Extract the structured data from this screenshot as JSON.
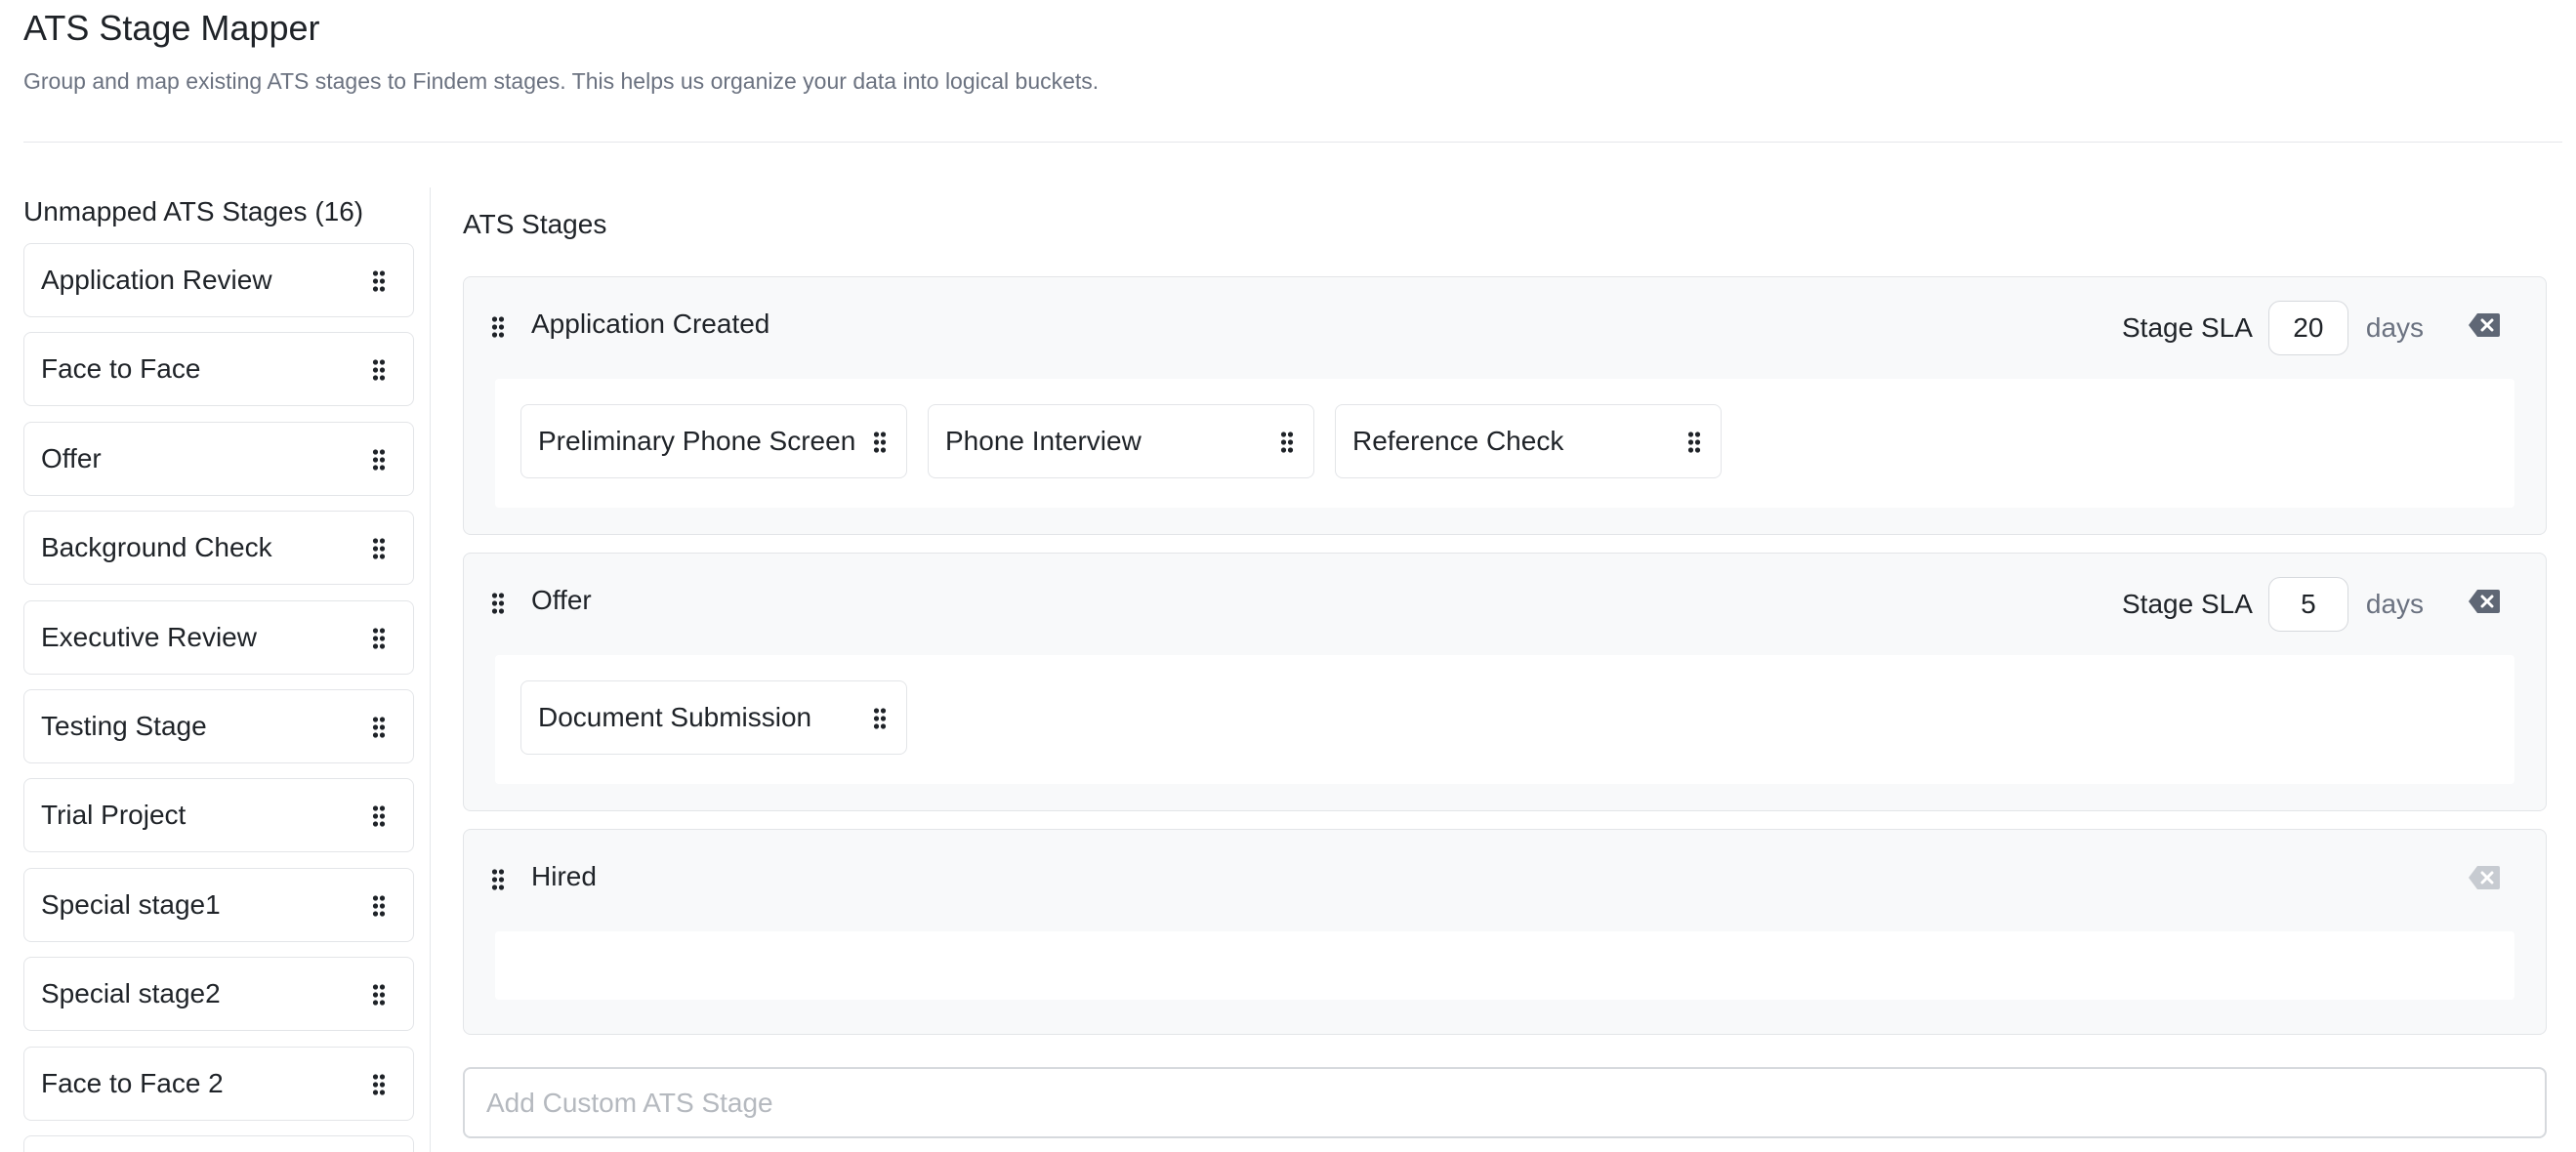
{
  "page": {
    "title": "ATS Stage Mapper",
    "subtitle": "Group and map existing ATS stages to Findem stages. This helps us organize your data into logical buckets."
  },
  "unmapped": {
    "heading": "Unmapped ATS Stages (16)",
    "items": [
      {
        "label": "Application Review",
        "icon": "drag-handle-icon"
      },
      {
        "label": "Face to Face",
        "icon": "drag-handle-icon"
      },
      {
        "label": "Offer",
        "icon": "drag-handle-icon"
      },
      {
        "label": "Background Check",
        "icon": "drag-handle-icon"
      },
      {
        "label": "Executive Review",
        "icon": "drag-handle-icon"
      },
      {
        "label": "Testing Stage",
        "icon": "drag-handle-icon"
      },
      {
        "label": "Trial Project",
        "icon": "drag-handle-icon"
      },
      {
        "label": "Special stage1",
        "icon": "drag-handle-icon"
      },
      {
        "label": "Special stage2",
        "icon": "drag-handle-icon"
      },
      {
        "label": "Face to Face 2",
        "icon": "drag-handle-icon"
      }
    ]
  },
  "mapped": {
    "heading": "ATS Stages",
    "sla_label": "Stage SLA",
    "days_label": "days",
    "groups": [
      {
        "name": "Application Created",
        "sla": "20",
        "delete_enabled": true,
        "stages": [
          "Preliminary Phone Screen",
          "Phone Interview",
          "Reference Check"
        ]
      },
      {
        "name": "Offer",
        "sla": "5",
        "delete_enabled": true,
        "stages": [
          "Document Submission"
        ]
      },
      {
        "name": "Hired",
        "sla": null,
        "delete_enabled": false,
        "stages": []
      }
    ],
    "custom_stage_placeholder": "Add Custom ATS Stage"
  },
  "icons": {
    "drag": "drag-handle-icon",
    "delete": "backspace-delete-icon"
  },
  "colors": {
    "text_primary": "#1f2328",
    "text_muted": "#6b7280",
    "border": "#e3e5e8",
    "group_bg": "#f8f9fa",
    "icon_active": "#5f6775",
    "icon_disabled": "#c7cbd1"
  }
}
